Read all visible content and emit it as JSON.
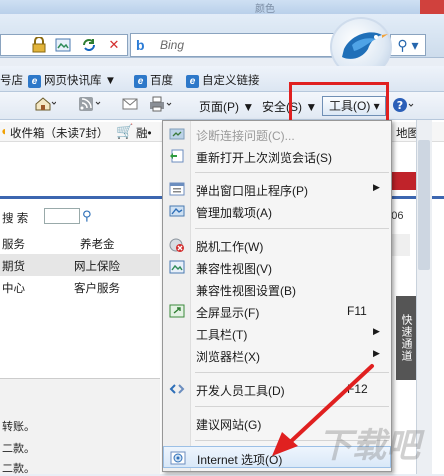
{
  "window": {
    "title": "颜色"
  },
  "search": {
    "provider": "Bing",
    "placeholder": "Bing"
  },
  "favorites": {
    "items": [
      {
        "label": "号店"
      },
      {
        "label": "网页快讯库 ▼"
      },
      {
        "label": "百度"
      },
      {
        "label": "自定义链接"
      }
    ]
  },
  "commandbar": {
    "page_label": "页面(P) ▼",
    "safety_label": "安全(S) ▼",
    "tools_label": "工具(O) ▾",
    "help_label": "?"
  },
  "webpage": {
    "mail_text": "收件箱（未读7封）",
    "mail_extra": "融•",
    "map_text": "地图",
    "search_label": "搜 索",
    "time_text": "04:06",
    "nav_rows": [
      {
        "left": "服务",
        "right": "养老金"
      },
      {
        "left": "期货",
        "right": "网上保险"
      },
      {
        "left": "中心",
        "right": "客户服务"
      }
    ],
    "lower_lines": [
      "转账。",
      "二款。",
      "二款。"
    ],
    "quick_tab": "快速通道"
  },
  "menu": {
    "items": [
      {
        "label": "诊断连接问题(C)...",
        "shortcut": "",
        "submenu": false,
        "disabled": true,
        "icon": "diagnose-icon"
      },
      {
        "label": "重新打开上次浏览会话(S)",
        "shortcut": "",
        "submenu": false,
        "disabled": false,
        "icon": "reopen-session-icon"
      },
      {
        "label": "弹出窗口阻止程序(P)",
        "shortcut": "",
        "submenu": true,
        "disabled": false,
        "icon": "popup-blocker-icon"
      },
      {
        "label": "管理加载项(A)",
        "shortcut": "",
        "submenu": false,
        "disabled": false,
        "icon": "addons-icon"
      },
      {
        "label": "脱机工作(W)",
        "shortcut": "",
        "submenu": false,
        "disabled": false,
        "icon": "offline-icon"
      },
      {
        "label": "兼容性视图(V)",
        "shortcut": "",
        "submenu": false,
        "disabled": false,
        "icon": "compat-view-icon"
      },
      {
        "label": "兼容性视图设置(B)",
        "shortcut": "",
        "submenu": false,
        "disabled": false,
        "icon": ""
      },
      {
        "label": "全屏显示(F)",
        "shortcut": "F11",
        "submenu": false,
        "disabled": false,
        "icon": "fullscreen-icon"
      },
      {
        "label": "工具栏(T)",
        "shortcut": "",
        "submenu": true,
        "disabled": false,
        "icon": ""
      },
      {
        "label": "浏览器栏(X)",
        "shortcut": "",
        "submenu": true,
        "disabled": false,
        "icon": ""
      },
      {
        "label": "开发人员工具(D)",
        "shortcut": "F12",
        "submenu": false,
        "disabled": false,
        "icon": "dev-tools-icon"
      },
      {
        "label": "建议网站(G)",
        "shortcut": "",
        "submenu": false,
        "disabled": false,
        "icon": ""
      },
      {
        "label": "Internet 选项(O)",
        "shortcut": "",
        "submenu": false,
        "disabled": false,
        "icon": "internet-options-icon"
      }
    ]
  },
  "colors": {
    "highlight_box": "#e02020",
    "arrow": "#e02020",
    "link_blue": "#2d78c9"
  }
}
